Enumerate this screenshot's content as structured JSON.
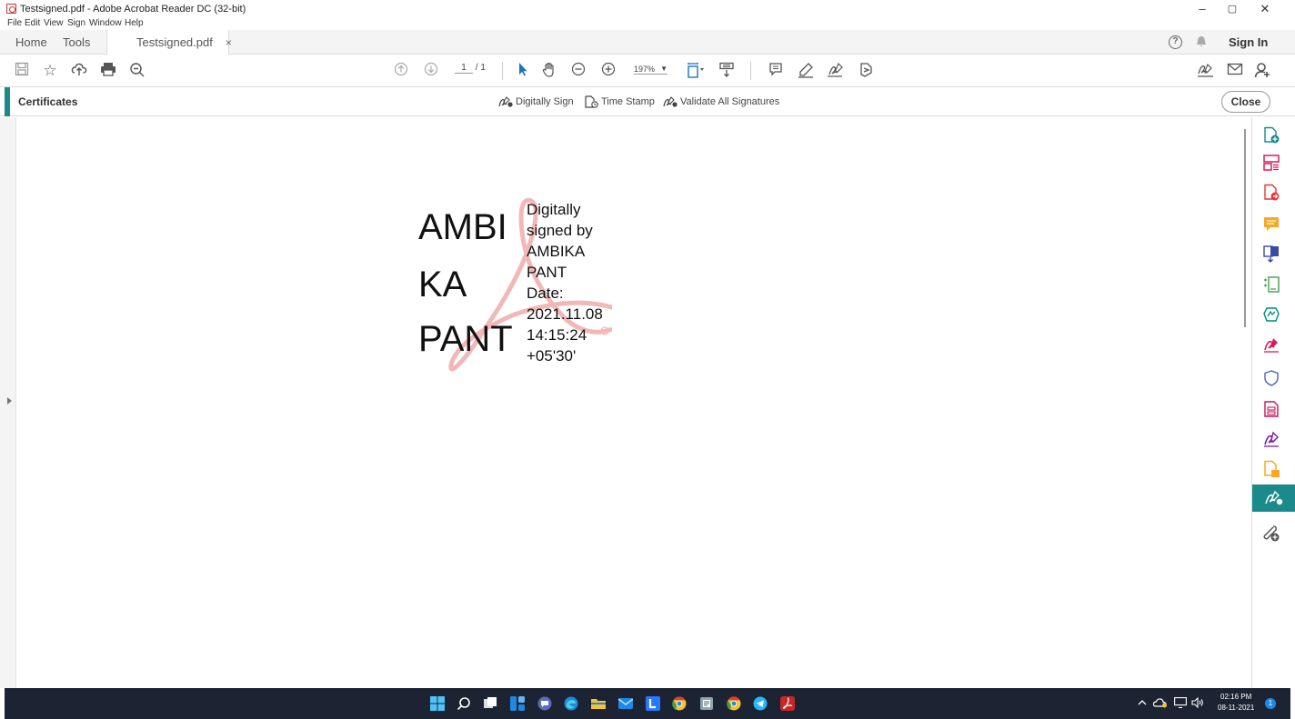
{
  "window": {
    "title": "Testsigned.pdf - Adobe Acrobat Reader DC (32-bit)",
    "minimize": "–",
    "maximize": "▢",
    "close": "✕"
  },
  "menu": [
    "File",
    "Edit",
    "View",
    "Sign",
    "Window",
    "Help"
  ],
  "tabs": {
    "home": "Home",
    "tools": "Tools",
    "document": "Testsigned.pdf",
    "close": "×",
    "sign_in": "Sign In"
  },
  "toolbar": {
    "page_current": "1",
    "page_total": "/ 1",
    "zoom": "197%"
  },
  "certificates": {
    "title": "Certificates",
    "digitally_sign": "Digitally Sign",
    "time_stamp": "Time Stamp",
    "validate_all": "Validate All Signatures",
    "close": "Close"
  },
  "signature": {
    "name_lines": [
      "AMBI",
      "KA",
      "PANT"
    ],
    "detail_lines": [
      "Digitally",
      "signed by",
      "AMBIKA",
      "PANT",
      "Date:",
      "2021.11.08",
      "14:15:24",
      "+05'30'"
    ]
  },
  "taskbar": {
    "time": "02:16 PM",
    "date": "08-11-2021",
    "notifications": "1"
  },
  "colors": {
    "accent_teal": "#1b8a8a",
    "acrobat_red": "#d32f2f",
    "taskbar_bg": "#1c2433"
  }
}
